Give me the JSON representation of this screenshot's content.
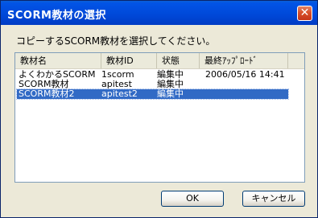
{
  "window": {
    "title": "SCORM教材の選択",
    "close_label": "✕"
  },
  "instruction": "コピーするSCORM教材を選択してください。",
  "list": {
    "columns": [
      "教材名",
      "教材ID",
      "状態",
      "最終ｱｯﾌﾟﾛｰﾄﾞ"
    ],
    "rows": [
      {
        "name": "よくわかるSCORM",
        "id": "1scorm",
        "status": "編集中",
        "last_upload": "2006/05/16 14:41"
      },
      {
        "name": "SCORM教材",
        "id": "apitest",
        "status": "編集中",
        "last_upload": ""
      },
      {
        "name": "SCORM教材2",
        "id": "apitest2",
        "status": "編集中",
        "last_upload": ""
      }
    ],
    "selected_index": 2
  },
  "buttons": {
    "ok": "OK",
    "cancel": "キャンセル"
  },
  "colors": {
    "titlebar": "#0048d8",
    "selection": "#316ac5",
    "dialog_bg": "#ece9d8"
  }
}
